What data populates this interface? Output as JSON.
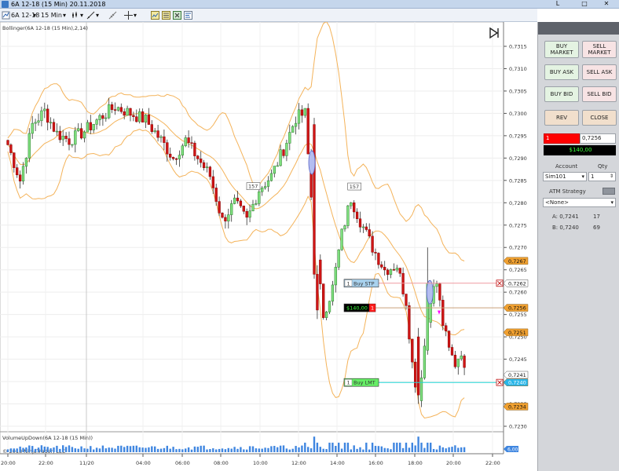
{
  "window": {
    "title": "6A 12-18 (15 Min)  20.11.2018",
    "minimize_label": "L",
    "maximize_label": "□",
    "close_label": "✕"
  },
  "toolbar": {
    "instrument": "6A 12-18",
    "interval": "15 Min"
  },
  "indicators": {
    "upper_label": "Bollinger(6A 12-18 (15 Min),2,14)",
    "lower_label": "VolumeUpDown(6A 12-18 (15 Min))"
  },
  "copyright": "© 2018 NinjaTrader, LLC",
  "price_axis": {
    "ticks": [
      "0,7315",
      "0,7310",
      "0,7305",
      "0,7300",
      "0,7295",
      "0,7290",
      "0,7285",
      "0,7280",
      "0,7275",
      "0,7270",
      "0,7265",
      "0,7260",
      "0,7255",
      "0,7250",
      "0,7245",
      "0,7240",
      "0,7235",
      "0,7230"
    ],
    "markers": [
      {
        "label": "0,7267",
        "price": 0.7267,
        "color": "#f0a030"
      },
      {
        "label": "0,7262",
        "price": 0.7262,
        "color": "#ffffff"
      },
      {
        "label": "0,7256",
        "price": 0.72565,
        "color": "#f0a030"
      },
      {
        "label": "0,7251",
        "price": 0.7251,
        "color": "#f0a030"
      },
      {
        "label": "0,7241",
        "price": 0.72415,
        "color": "#ffffff"
      },
      {
        "label": "0,7240",
        "price": 0.72398,
        "color": "#2ab6e8"
      },
      {
        "label": "0,7234",
        "price": 0.72344,
        "color": "#f0a030"
      }
    ],
    "volume_marker": "6,00"
  },
  "time_axis": [
    "20:00",
    "22:00",
    "11/20",
    "04:00",
    "06:00",
    "08:00",
    "10:00",
    "12:00",
    "14:00",
    "16:00",
    "18:00",
    "20:00",
    "22:00"
  ],
  "orders": [
    {
      "name": "buy-stop-order",
      "qty": "1",
      "label": "Buy STP",
      "price": 0.7262,
      "color": "#a9d2ee"
    },
    {
      "name": "position-order",
      "qty": "",
      "label": "$140,00",
      "price": 0.72565,
      "color": "#000000"
    },
    {
      "name": "buy-limit-order",
      "qty": "1",
      "label": "Buy LMT",
      "price": 0.72398,
      "color": "#66ee66"
    }
  ],
  "position": {
    "qty": "1",
    "price": "0,7256",
    "pnl": "$140,00"
  },
  "bar_labels": [
    {
      "label": "157",
      "bar": 80
    },
    {
      "label": "157",
      "bar": 113
    }
  ],
  "chart_data": {
    "type": "candlestick",
    "interval": "15 Min",
    "ylim": [
      0.7227,
      0.732
    ],
    "ohlc_summary": "Bars oscillate between 0.7280 and 0.7303 until 12:00, drop to 0.7255, recover to 0.7283, fall to 0.7235 then rebound near 0.7245",
    "bollinger": {
      "period": 14,
      "std": 2
    }
  },
  "panel": {
    "buttons": [
      {
        "name": "buy-market-button",
        "label": "BUY MARKET",
        "kind": "buy"
      },
      {
        "name": "sell-market-button",
        "label": "SELL MARKET",
        "kind": "sell"
      },
      {
        "name": "buy-ask-button",
        "label": "BUY ASK",
        "kind": "buy"
      },
      {
        "name": "sell-ask-button",
        "label": "SELL ASK",
        "kind": "sell"
      },
      {
        "name": "buy-bid-button",
        "label": "BUY BID",
        "kind": "buy"
      },
      {
        "name": "sell-bid-button",
        "label": "SELL BID",
        "kind": "sell"
      },
      {
        "name": "rev-button",
        "label": "REV",
        "kind": "rev"
      },
      {
        "name": "close-button",
        "label": "CLOSE",
        "kind": "rev"
      }
    ],
    "account_label": "Account",
    "qty_label": "Qty",
    "account_value": "Sim101",
    "qty_value": "1",
    "atm_label": "ATM Strategy",
    "atm_value": "<None>",
    "ask_label": "A: 0,7241",
    "ask_size": "17",
    "bid_label": "B: 0,7240",
    "bid_size": "69"
  }
}
